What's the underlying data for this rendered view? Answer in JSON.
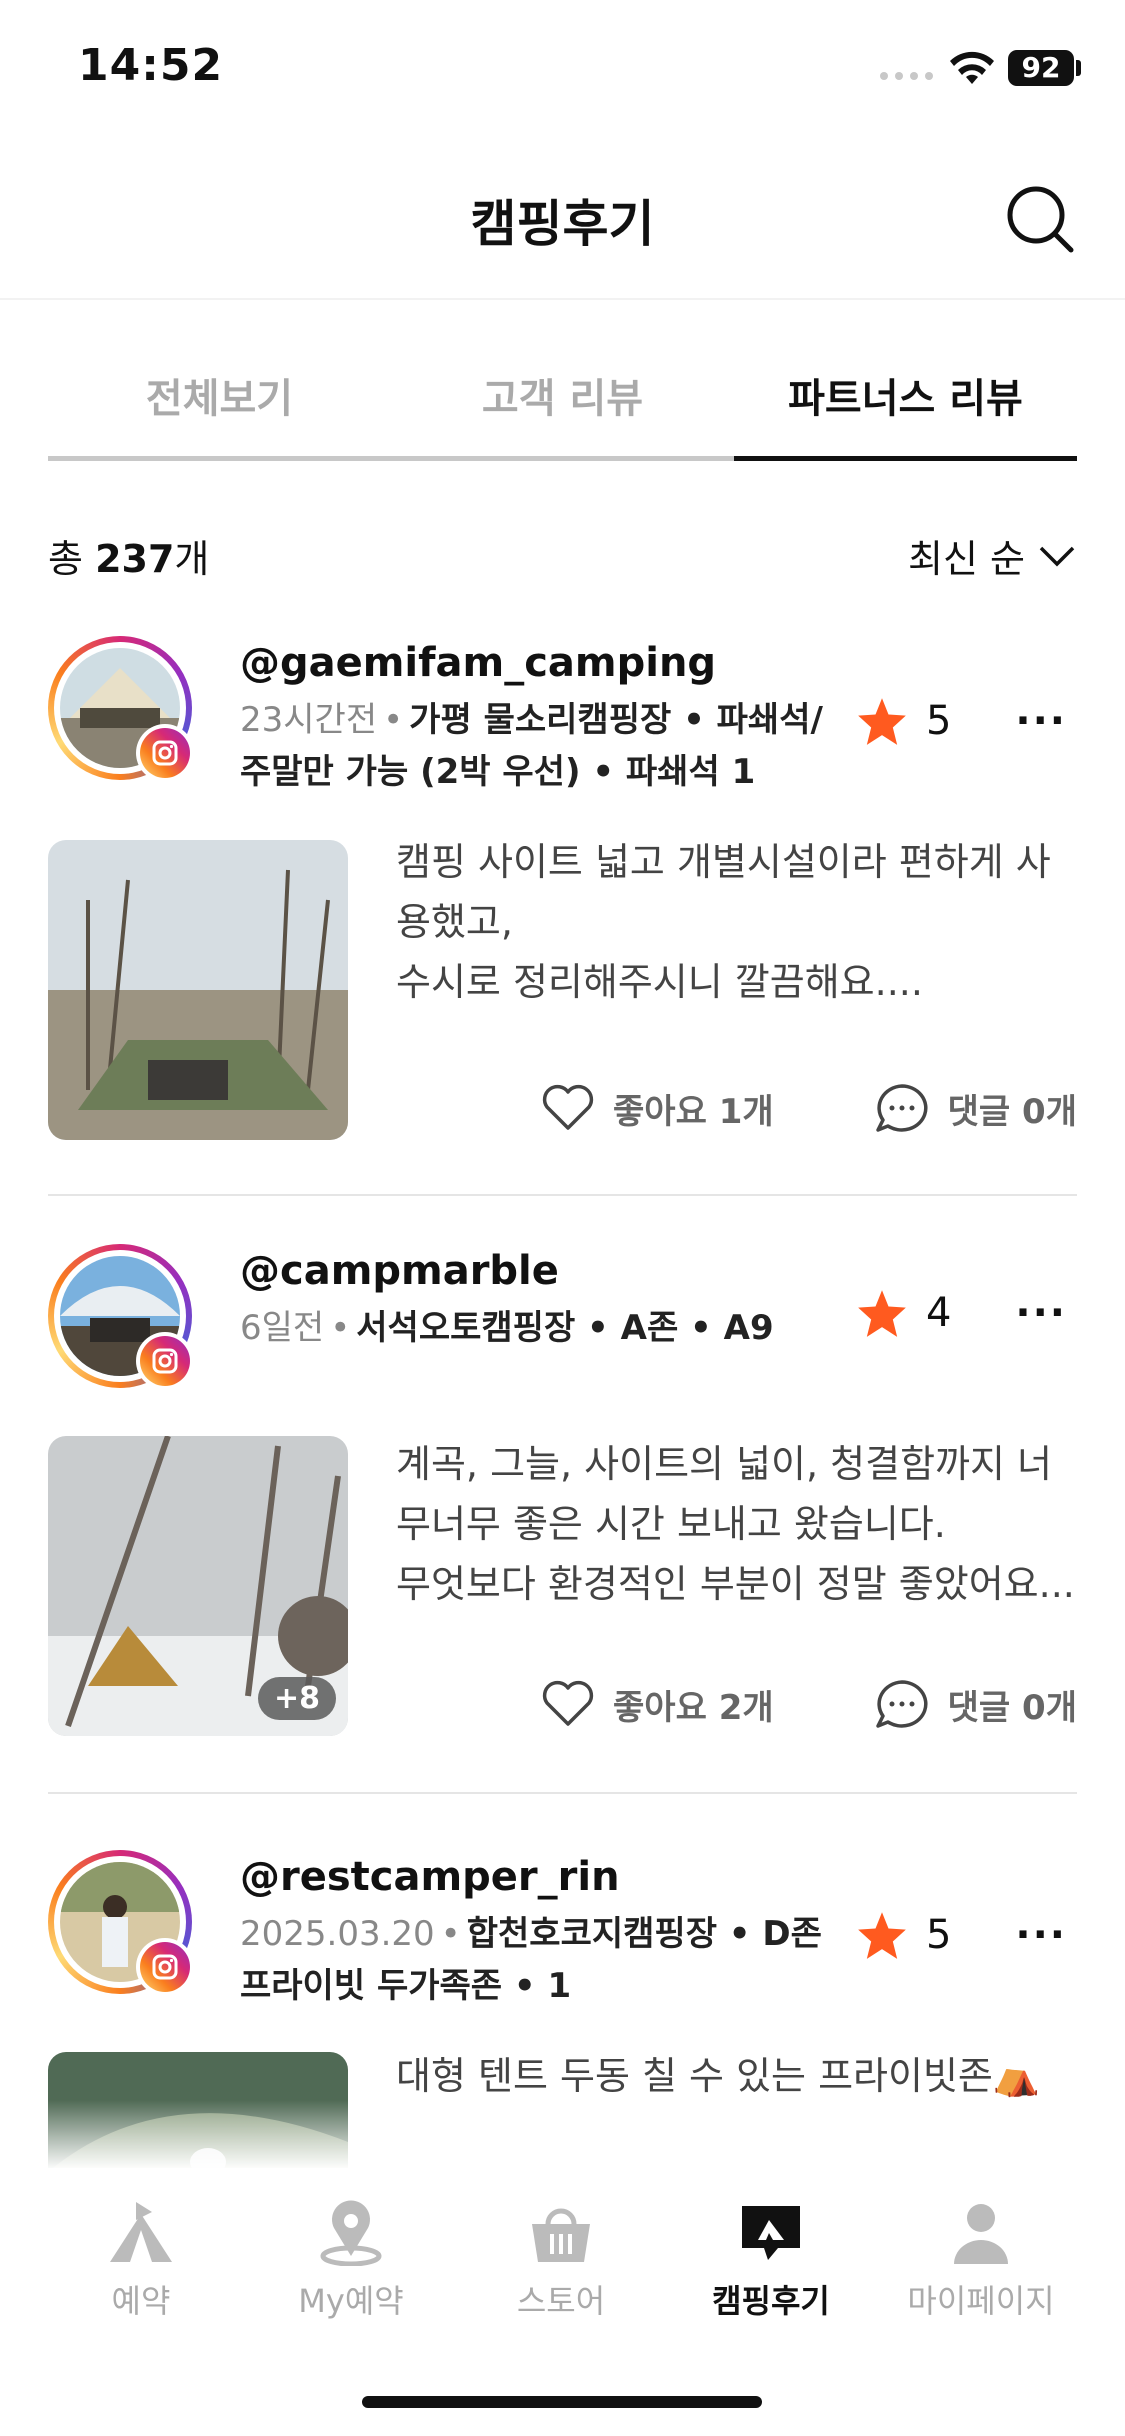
{
  "status_bar": {
    "time": "14:52",
    "battery": "92"
  },
  "header": {
    "title": "캠핑후기"
  },
  "tabs": [
    {
      "label": "전체보기",
      "active": false
    },
    {
      "label": "고객 리뷰",
      "active": false
    },
    {
      "label": "파트너스 리뷰",
      "active": true
    }
  ],
  "summary": {
    "total_prefix": "총",
    "total_count": "237",
    "total_suffix": "개",
    "sort_label": "최신 순"
  },
  "reviews": [
    {
      "username": "@gaemifam_camping",
      "time": "23시간전",
      "location": "가평 물소리캠핑장 • 파쇄석/ 주말만 가능 (2박 우선) • 파쇄석 1",
      "rating": "5",
      "text": "캠핑 사이트 넓고 개별시설이라 편하게 사용했고,\n수시로 정리해주시니 깔끔해요....",
      "likes": "좋아요 1개",
      "comments": "댓글 0개",
      "photo_count": ""
    },
    {
      "username": "@campmarble",
      "time": "6일전",
      "location": "서석오토캠핑장 • A존 • A9",
      "rating": "4",
      "text": "계곡, 그늘, 사이트의 넓이, 청결함까지 너무너무 좋은 시간 보내고 왔습니다.\n무엇보다 환경적인 부분이 정말 좋았어요...",
      "likes": "좋아요 2개",
      "comments": "댓글 0개",
      "photo_count": "+8"
    },
    {
      "username": "@restcamper_rin",
      "time": "2025.03.20",
      "location": "합천호코지캠핑장 • D존 프라이빗 두가족존 • 1",
      "rating": "5",
      "text": "대형 텐트 두동 칠 수 있는 프라이빗존⛺",
      "likes": "",
      "comments": "",
      "photo_count": ""
    }
  ],
  "bottom_nav": [
    {
      "label": "예약",
      "icon": "tent-icon",
      "active": false
    },
    {
      "label": "My예약",
      "icon": "map-pin-icon",
      "active": false
    },
    {
      "label": "스토어",
      "icon": "shopping-basket-icon",
      "active": false
    },
    {
      "label": "캠핑후기",
      "icon": "review-bubble-icon",
      "active": true
    },
    {
      "label": "마이페이지",
      "icon": "person-icon",
      "active": false
    }
  ],
  "colors": {
    "star": "#FF5A1F",
    "active": "#111111",
    "inactive": "#AAAAAA"
  }
}
